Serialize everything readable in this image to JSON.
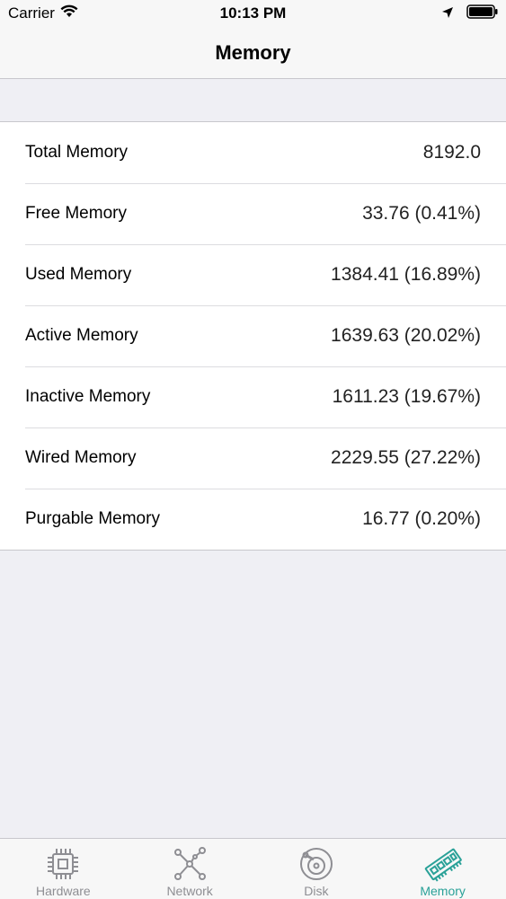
{
  "status_bar": {
    "carrier": "Carrier",
    "time": "10:13 PM"
  },
  "nav": {
    "title": "Memory"
  },
  "rows": [
    {
      "label": "Total Memory",
      "value": "8192.0"
    },
    {
      "label": "Free Memory",
      "value": "33.76 (0.41%)"
    },
    {
      "label": "Used Memory",
      "value": "1384.41 (16.89%)"
    },
    {
      "label": "Active Memory",
      "value": "1639.63 (20.02%)"
    },
    {
      "label": "Inactive Memory",
      "value": "1611.23 (19.67%)"
    },
    {
      "label": "Wired Memory",
      "value": "2229.55 (27.22%)"
    },
    {
      "label": "Purgable Memory",
      "value": "16.77 (0.20%)"
    }
  ],
  "tabs": [
    {
      "label": "Hardware",
      "icon": "cpu-chip-icon",
      "active": false
    },
    {
      "label": "Network",
      "icon": "network-nodes-icon",
      "active": false
    },
    {
      "label": "Disk",
      "icon": "disk-icon",
      "active": false
    },
    {
      "label": "Memory",
      "icon": "memory-module-icon",
      "active": true
    }
  ],
  "colors": {
    "accent": "#2aa198",
    "inactive_tab": "#8e8e93",
    "background": "#efeff4"
  }
}
